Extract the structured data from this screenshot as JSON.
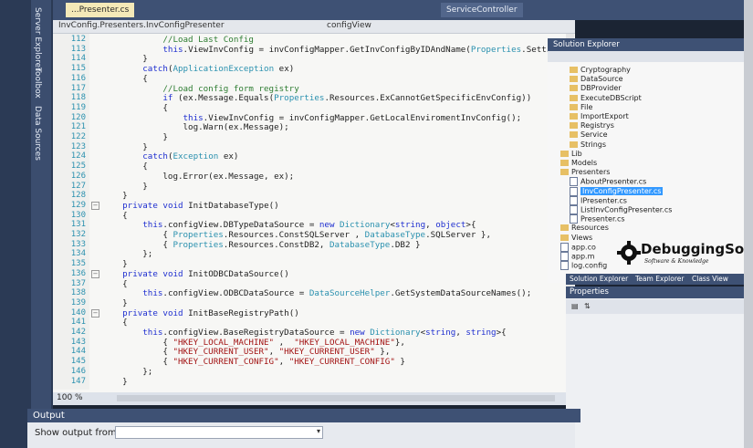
{
  "window": {
    "tabs": [
      {
        "label": "...Presenter.cs",
        "active": true
      },
      {
        "label": "ServiceController",
        "active": false
      }
    ],
    "side_tabs": [
      "Server Explorer",
      "Toolbox",
      "Data Sources"
    ]
  },
  "editor": {
    "nav_left": "InvConfig.Presenters.InvConfigPresenter",
    "nav_right": "configView",
    "zoom": "100 %",
    "lines": [
      {
        "n": "112",
        "t": "            //Load Last Config"
      },
      {
        "n": "113",
        "t": "            this.ViewInvConfig = invConfigMapper.GetInvConfigByIDAndName(Properties.Settings.Default.Las"
      },
      {
        "n": "114",
        "t": "        }"
      },
      {
        "n": "115",
        "t": "        catch(ApplicationException ex)"
      },
      {
        "n": "116",
        "t": "        {"
      },
      {
        "n": "117",
        "t": "            //Load config form registry"
      },
      {
        "n": "118",
        "t": "            if (ex.Message.Equals(Properties.Resources.ExCannotGetSpecificEnvConfig))"
      },
      {
        "n": "119",
        "t": "            {"
      },
      {
        "n": "120",
        "t": "                this.ViewInvConfig = invConfigMapper.GetLocalEnviromentInvConfig();"
      },
      {
        "n": "121",
        "t": "                log.Warn(ex.Message);"
      },
      {
        "n": "122",
        "t": "            }"
      },
      {
        "n": "123",
        "t": "        }"
      },
      {
        "n": "124",
        "t": "        catch(Exception ex)"
      },
      {
        "n": "125",
        "t": "        {"
      },
      {
        "n": "126",
        "t": "            log.Error(ex.Message, ex);"
      },
      {
        "n": "127",
        "t": "        }"
      },
      {
        "n": "128",
        "t": "    }"
      },
      {
        "n": "129",
        "t": "    private void InitDatabaseType()"
      },
      {
        "n": "130",
        "t": "    {"
      },
      {
        "n": "131",
        "t": "        this.configView.DBTypeDataSource = new Dictionary<string, object>{"
      },
      {
        "n": "132",
        "t": "            { Properties.Resources.ConstSQLServer , DatabaseType.SQLServer },"
      },
      {
        "n": "133",
        "t": "            { Properties.Resources.ConstDB2, DatabaseType.DB2 }"
      },
      {
        "n": "134",
        "t": "        };"
      },
      {
        "n": "135",
        "t": "    }"
      },
      {
        "n": "136",
        "t": "    private void InitODBCDataSource()"
      },
      {
        "n": "137",
        "t": "    {"
      },
      {
        "n": "138",
        "t": "        this.configView.ODBCDataSource = DataSourceHelper.GetSystemDataSourceNames();"
      },
      {
        "n": "139",
        "t": "    }"
      },
      {
        "n": "140",
        "t": "    private void InitBaseRegistryPath()"
      },
      {
        "n": "141",
        "t": "    {"
      },
      {
        "n": "142",
        "t": "        this.configView.BaseRegistryDataSource = new Dictionary<string, string>{"
      },
      {
        "n": "143",
        "t": "            { \"HKEY_LOCAL_MACHINE\" ,  \"HKEY_LOCAL_MACHINE\"},"
      },
      {
        "n": "144",
        "t": "            { \"HKEY_CURRENT_USER\", \"HKEY_CURRENT_USER\" },"
      },
      {
        "n": "145",
        "t": "            { \"HKEY_CURRENT_CONFIG\", \"HKEY_CURRENT_CONFIG\" }"
      },
      {
        "n": "146",
        "t": "        };"
      },
      {
        "n": "147",
        "t": "    }"
      }
    ]
  },
  "solution_explorer": {
    "title": "Solution Explorer",
    "items": [
      {
        "label": "Cryptography",
        "kind": "folder",
        "level": 2
      },
      {
        "label": "DataSource",
        "kind": "folder",
        "level": 2
      },
      {
        "label": "DBProvider",
        "kind": "folder",
        "level": 2
      },
      {
        "label": "ExecuteDBScript",
        "kind": "folder",
        "level": 2
      },
      {
        "label": "File",
        "kind": "folder",
        "level": 2
      },
      {
        "label": "ImportExport",
        "kind": "folder",
        "level": 2
      },
      {
        "label": "Registrys",
        "kind": "folder",
        "level": 2
      },
      {
        "label": "Service",
        "kind": "folder",
        "level": 2
      },
      {
        "label": "Strings",
        "kind": "folder",
        "level": 2
      },
      {
        "label": "Lib",
        "kind": "folder",
        "level": 1
      },
      {
        "label": "Models",
        "kind": "folder",
        "level": 1
      },
      {
        "label": "Presenters",
        "kind": "folder",
        "level": 1
      },
      {
        "label": "AboutPresenter.cs",
        "kind": "file",
        "level": 2
      },
      {
        "label": "InvConfigPresenter.cs",
        "kind": "file",
        "level": 2,
        "selected": true
      },
      {
        "label": "IPresenter.cs",
        "kind": "file",
        "level": 2
      },
      {
        "label": "ListInvConfigPresenter.cs",
        "kind": "file",
        "level": 2
      },
      {
        "label": "Presenter.cs",
        "kind": "file",
        "level": 2
      },
      {
        "label": "Resources",
        "kind": "folder",
        "level": 1
      },
      {
        "label": "Views",
        "kind": "folder",
        "level": 1
      },
      {
        "label": "app.co",
        "kind": "file",
        "level": 1
      },
      {
        "label": "app.m",
        "kind": "file",
        "level": 1
      },
      {
        "label": "log.config",
        "kind": "file",
        "level": 1
      }
    ],
    "tabs": [
      "Solution Explorer",
      "Team Explorer",
      "Class View"
    ]
  },
  "logo": {
    "main": "DebuggingSoft",
    "sub": "Software & Knowledge"
  },
  "properties": {
    "title": "Properties"
  },
  "output": {
    "title": "Output",
    "label": "Show output from:",
    "value": ""
  }
}
